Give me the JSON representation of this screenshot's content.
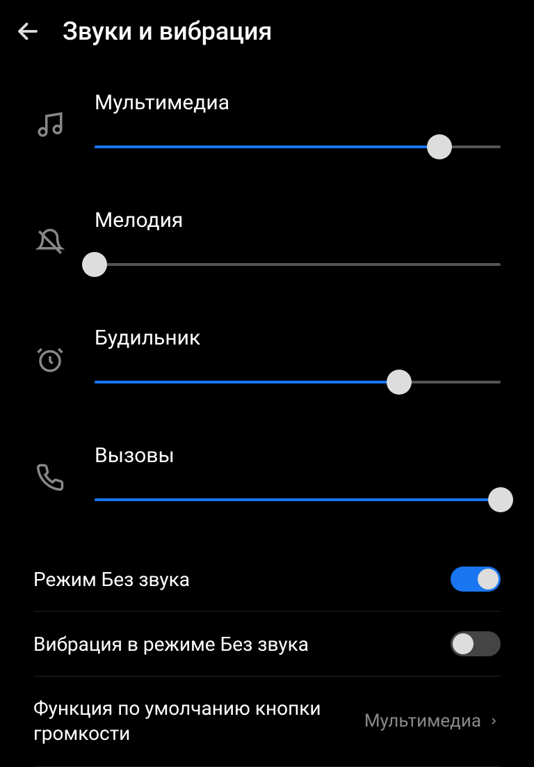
{
  "header": {
    "title": "Звуки и вибрация"
  },
  "sliders": [
    {
      "label": "Мультимедиа",
      "icon": "music",
      "value": 85
    },
    {
      "label": "Мелодия",
      "icon": "bell-off",
      "value": 0
    },
    {
      "label": "Будильник",
      "icon": "alarm",
      "value": 75
    },
    {
      "label": "Вызовы",
      "icon": "phone",
      "value": 100
    }
  ],
  "settings": {
    "silent_mode": {
      "label": "Режим Без звука",
      "on": true
    },
    "vibrate_silent": {
      "label": "Вибрация в режиме Без звука",
      "on": false
    },
    "volume_key_default": {
      "label": "Функция по умолчанию кнопки громкости",
      "value": "Мультимедиа"
    }
  }
}
